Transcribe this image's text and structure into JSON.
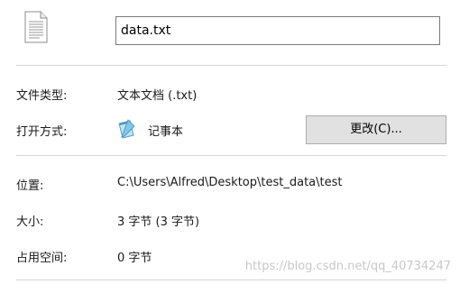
{
  "file": {
    "name_value": "data.txt",
    "icon": "text-document-icon"
  },
  "properties": {
    "type_label": "文件类型:",
    "type_value": "文本文档 (.txt)",
    "open_with_label": "打开方式:",
    "open_with_app": "记事本",
    "open_with_icon": "notepad-icon",
    "change_button": "更改(C)...",
    "location_label": "位置:",
    "location_value": "C:\\Users\\Alfred\\Desktop\\test_data\\test",
    "size_label": "大小:",
    "size_value": "3 字节 (3 字节)",
    "size_on_disk_label": "占用空间:",
    "size_on_disk_value": "0 字节"
  },
  "watermark": "https://blog.csdn.net/qq_40734247"
}
